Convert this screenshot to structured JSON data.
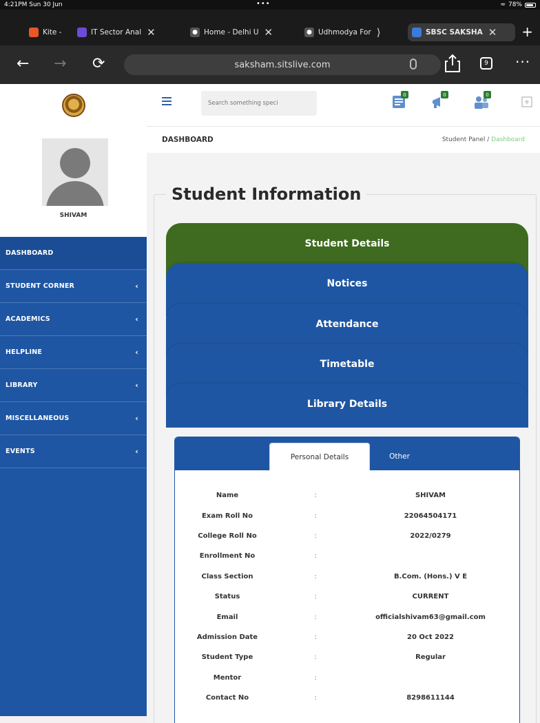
{
  "status_bar": {
    "time": "4:21PM  Sun 30 Jun",
    "dots": "•••",
    "battery": "78%"
  },
  "browser": {
    "tabs": [
      {
        "label": "Kite -",
        "color": "#e8562a"
      },
      {
        "label": "IT Sector Anal",
        "color": "#6b4bd8"
      },
      {
        "label": "Home - Delhi U",
        "color": "#555555"
      },
      {
        "label": "Udhmodya For",
        "color": "#555555"
      },
      {
        "label": "SBSC SAKSHA",
        "color": "#3d7bd8"
      }
    ],
    "url": "saksham.sitslive.com",
    "tab_count": "9"
  },
  "header": {
    "search_placeholder": "Search something speci",
    "icons": [
      {
        "name": "notices-icon",
        "badge": "0"
      },
      {
        "name": "announcement-icon",
        "badge": "0"
      },
      {
        "name": "users-icon",
        "badge": "0"
      },
      {
        "name": "expand-icon",
        "badge": ""
      }
    ]
  },
  "profile": {
    "name": "SHIVAM"
  },
  "sidebar": {
    "items": [
      {
        "label": "DASHBOARD",
        "has_children": false
      },
      {
        "label": "STUDENT CORNER",
        "has_children": true
      },
      {
        "label": "ACADEMICS",
        "has_children": true
      },
      {
        "label": "HELPLINE",
        "has_children": true
      },
      {
        "label": "LIBRARY",
        "has_children": true
      },
      {
        "label": "MISCELLANEOUS",
        "has_children": true
      },
      {
        "label": "EVENTS",
        "has_children": true
      }
    ]
  },
  "page": {
    "title": "DASHBOARD",
    "breadcrumb_root": "Student Panel /",
    "breadcrumb_current": "Dashboard",
    "section_title": "Student Information"
  },
  "accordion": [
    "Student Details",
    "Notices",
    "Attendance",
    "Timetable",
    "Library Details"
  ],
  "details_tabs": {
    "active": "Personal Details",
    "other": "Other"
  },
  "details": [
    {
      "label": "Name",
      "sep": ":",
      "value": "SHIVAM"
    },
    {
      "label": "Exam Roll No",
      "sep": ":",
      "value": "22064504171"
    },
    {
      "label": "College Roll No",
      "sep": ":",
      "value": "2022/0279"
    },
    {
      "label": "Enrollment No",
      "sep": ":",
      "value": ""
    },
    {
      "label": "Class Section",
      "sep": ":",
      "value": "B.Com. (Hons.) V E"
    },
    {
      "label": "Status",
      "sep": ":",
      "value": "CURRENT"
    },
    {
      "label": "Email",
      "sep": ":",
      "value": "officialshivam63@gmail.com"
    },
    {
      "label": "Admission Date",
      "sep": ":",
      "value": "20 Oct 2022"
    },
    {
      "label": "Student Type",
      "sep": ":",
      "value": "Regular"
    },
    {
      "label": "Mentor",
      "sep": ":",
      "value": ""
    },
    {
      "label": "Contact No",
      "sep": ":",
      "value": "8298611144"
    }
  ],
  "colors": {
    "primary": "#1f56a3",
    "accent_green": "#3e6b20",
    "badge_green": "#2e7d32"
  }
}
